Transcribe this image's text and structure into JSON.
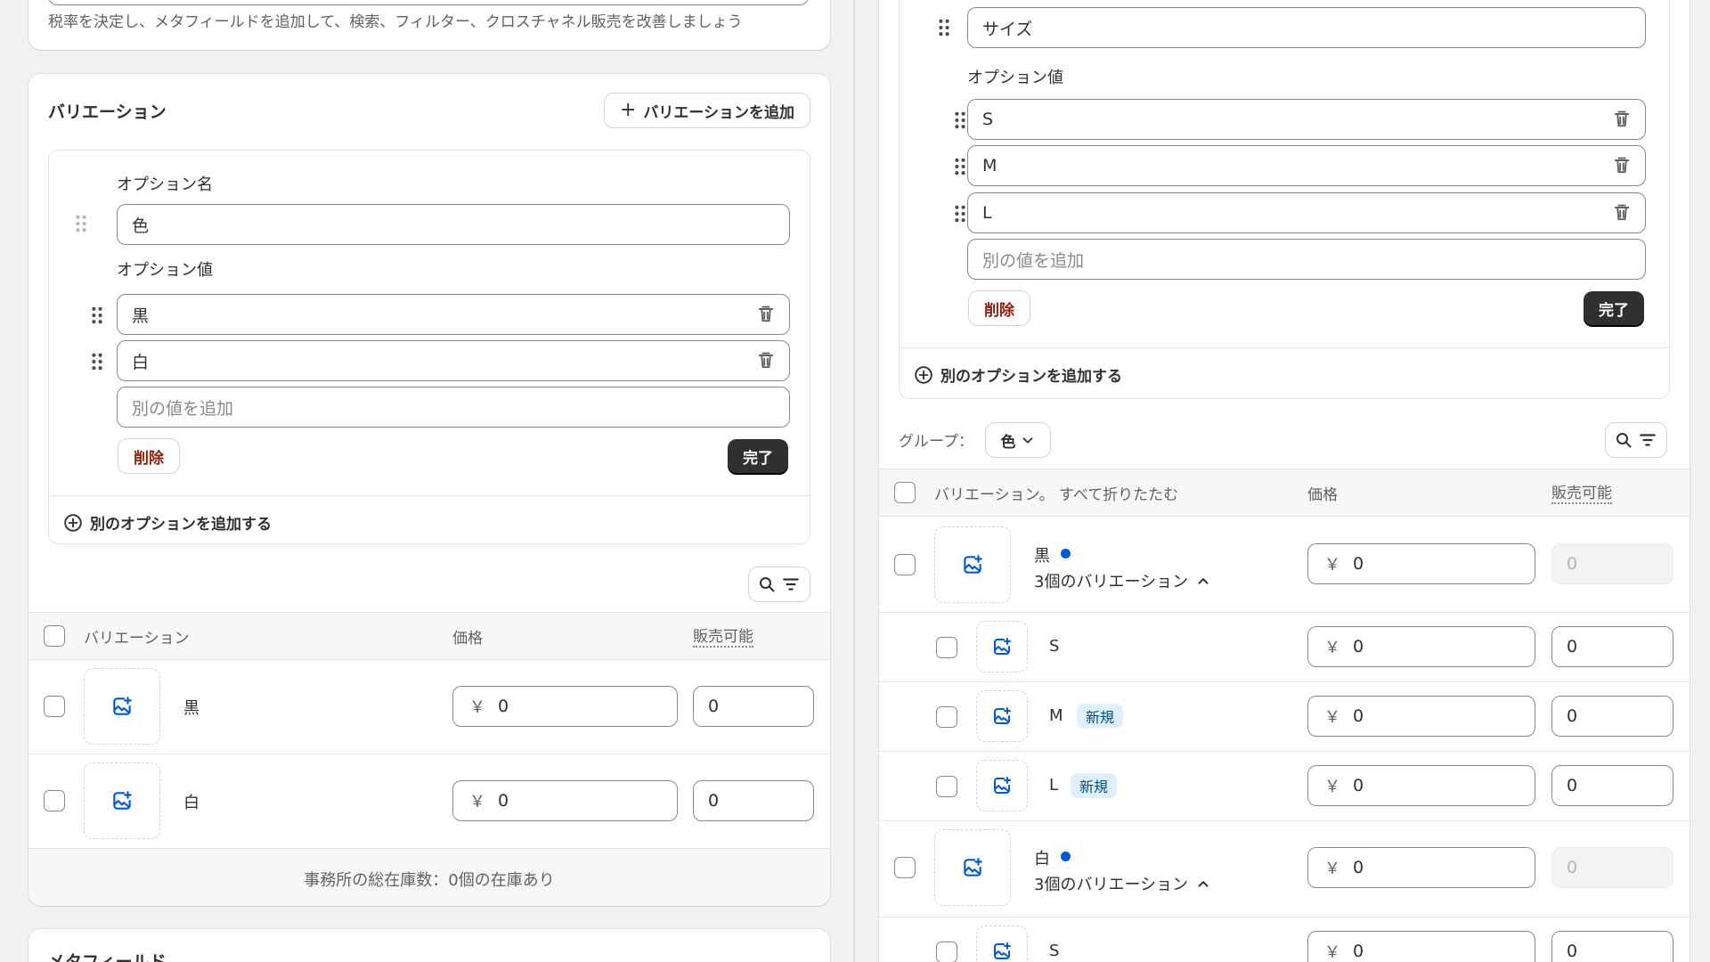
{
  "left": {
    "top_description": "税率を決定し、メタフィールドを追加して、検索、フィルター、クロスチャネル販売を改善しましょう",
    "variations_title": "バリエーション",
    "add_variation_label": "バリエーションを追加",
    "option_name_label": "オプション名",
    "option_name_value": "色",
    "option_values_label": "オプション値",
    "option_values": [
      "黒",
      "白"
    ],
    "add_value_placeholder": "別の値を追加",
    "delete_label": "削除",
    "done_label": "完了",
    "add_option_label": "別のオプションを追加する",
    "table": {
      "col_variation": "バリエーション",
      "col_price": "価格",
      "col_available": "販売可能",
      "rows": [
        {
          "name": "黒",
          "price": "0",
          "available": "0"
        },
        {
          "name": "白",
          "price": "0",
          "available": "0"
        }
      ]
    },
    "currency": "￥",
    "inventory_summary": "事務所の総在庫数：0個の在庫あり",
    "metafields_title": "メタフィールド"
  },
  "right": {
    "option_name_value": "サイズ",
    "option_values_label": "オプション値",
    "option_values": [
      "S",
      "M",
      "L"
    ],
    "add_value_placeholder": "別の値を追加",
    "delete_label": "削除",
    "done_label": "完了",
    "add_option_label": "別のオプションを追加する",
    "group_label": "グループ：",
    "group_value": "色",
    "table": {
      "col_variation": "バリエーション",
      "collapse_all": "。 すべて折りたたむ",
      "col_price": "価格",
      "col_available": "販売可能",
      "groups": [
        {
          "name": "黒",
          "sub": "3個のバリエーション",
          "price": "0",
          "available": "0",
          "children": [
            {
              "name": "S",
              "price": "0",
              "available": "0"
            },
            {
              "name": "M",
              "badge": "新規",
              "price": "0",
              "available": "0"
            },
            {
              "name": "L",
              "badge": "新規",
              "price": "0",
              "available": "0"
            }
          ]
        },
        {
          "name": "白",
          "sub": "3個のバリエーション",
          "price": "0",
          "available": "0",
          "children": [
            {
              "name": "S",
              "price": "0",
              "available": "0"
            }
          ]
        }
      ]
    },
    "currency": "￥"
  },
  "colors": {
    "accent_blue": "#005bd3",
    "primary_button": "#303030",
    "danger_text": "#8e1f0b",
    "badge_bg": "#e0f0ff"
  }
}
